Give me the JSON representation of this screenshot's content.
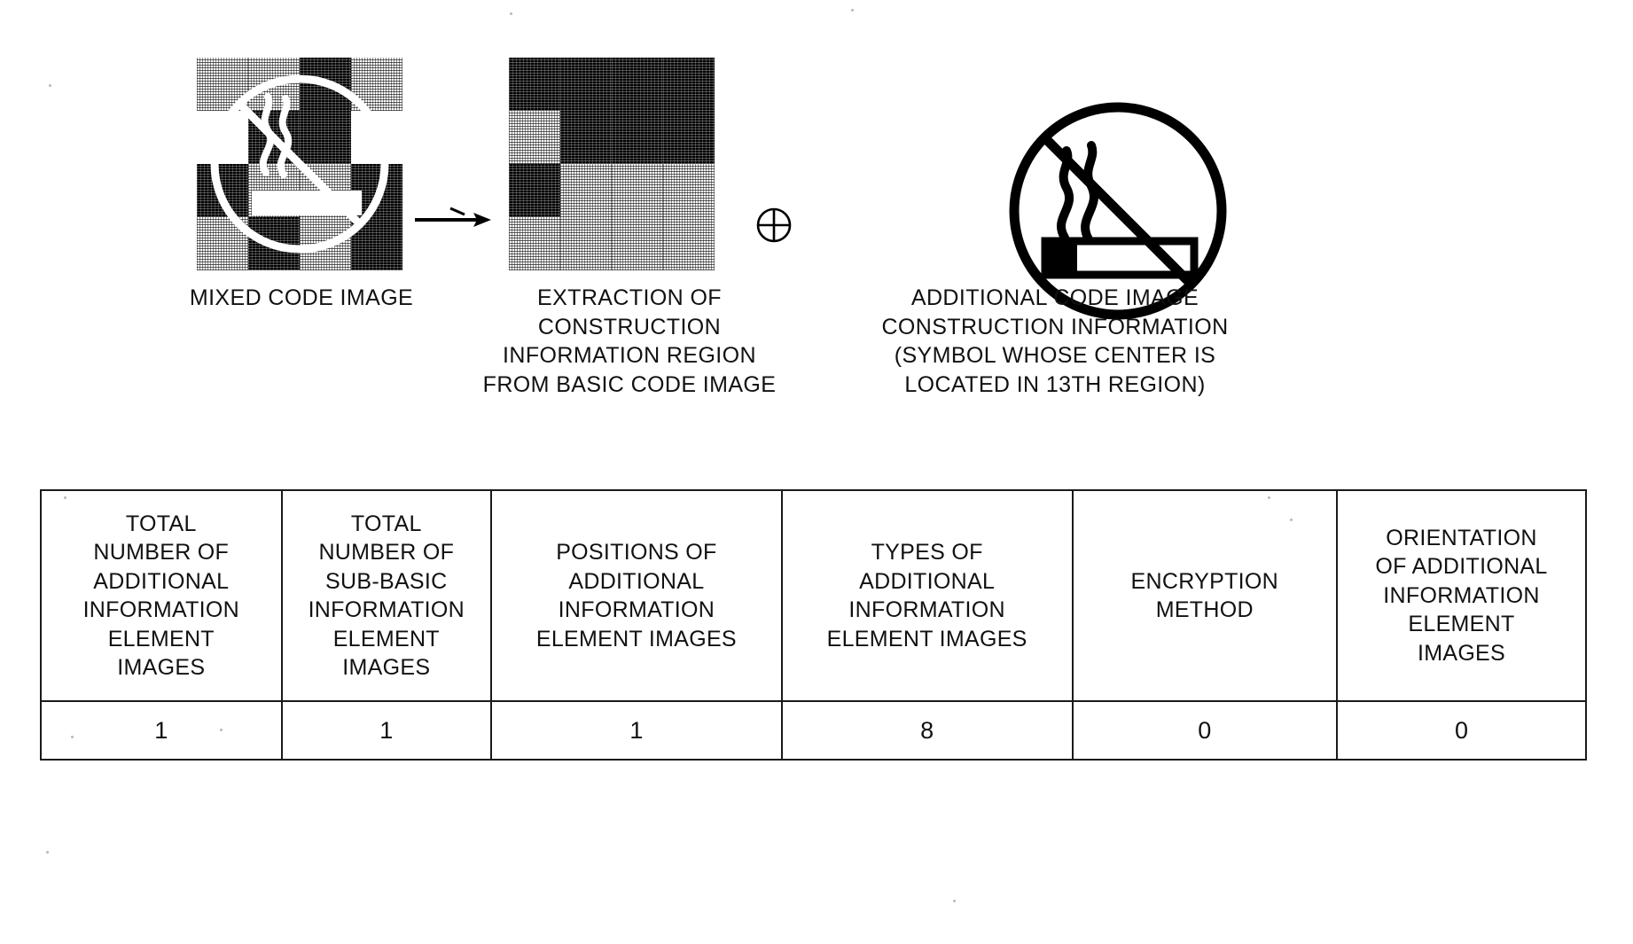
{
  "figure": {
    "type": "patent-diagram",
    "description": "Mixed code image decomposition into basic code construction information region and additional code image, with construction information table",
    "operator_symbol": "circled-plus"
  },
  "captions": {
    "mixed_code_image": "MIXED CODE IMAGE",
    "extraction": "EXTRACTION OF\nCONSTRUCTION\nINFORMATION REGION\nFROM BASIC CODE IMAGE",
    "additional_code": "ADDITIONAL CODE IMAGE\nCONSTRUCTION INFORMATION\n(SYMBOL WHOSE CENTER IS\nLOCATED IN 13TH REGION)"
  },
  "code_images": {
    "mixed": {
      "label": "mixed-code-image",
      "grid_rows": 4,
      "grid_cols": 4,
      "cells": [
        "gray",
        "gray",
        "black",
        "gray",
        "white",
        "black",
        "black",
        "white",
        "black",
        "gray",
        "gray",
        "black",
        "gray",
        "black",
        "gray",
        "black"
      ]
    },
    "extracted": {
      "label": "construction-information-region",
      "grid_rows": 4,
      "grid_cols": 4,
      "cells": [
        "black",
        "black",
        "black",
        "black",
        "gray",
        "black",
        "black",
        "black",
        "black",
        "gray",
        "gray",
        "gray",
        "gray",
        "gray",
        "gray",
        "gray"
      ],
      "accent_cells": [
        "black",
        "gray",
        "black",
        "black"
      ]
    }
  },
  "table": {
    "name": "additional-code-image-construction-information",
    "headers": [
      "TOTAL\nNUMBER OF\nADDITIONAL\nINFORMATION\nELEMENT\nIMAGES",
      "TOTAL\nNUMBER OF\nSUB-BASIC\nINFORMATION\nELEMENT\nIMAGES",
      "POSITIONS OF\nADDITIONAL\nINFORMATION\nELEMENT IMAGES",
      "TYPES OF\nADDITIONAL\nINFORMATION\nELEMENT IMAGES",
      "ENCRYPTION\nMETHOD",
      "ORIENTATION\nOF ADDITIONAL\nINFORMATION\nELEMENT\nIMAGES"
    ],
    "rows": [
      [
        "1",
        "1",
        "1",
        "8",
        "0",
        "0"
      ]
    ]
  },
  "colors": {
    "ink": "#111111",
    "border": "#1a1a1a",
    "paper": "#ffffff"
  }
}
